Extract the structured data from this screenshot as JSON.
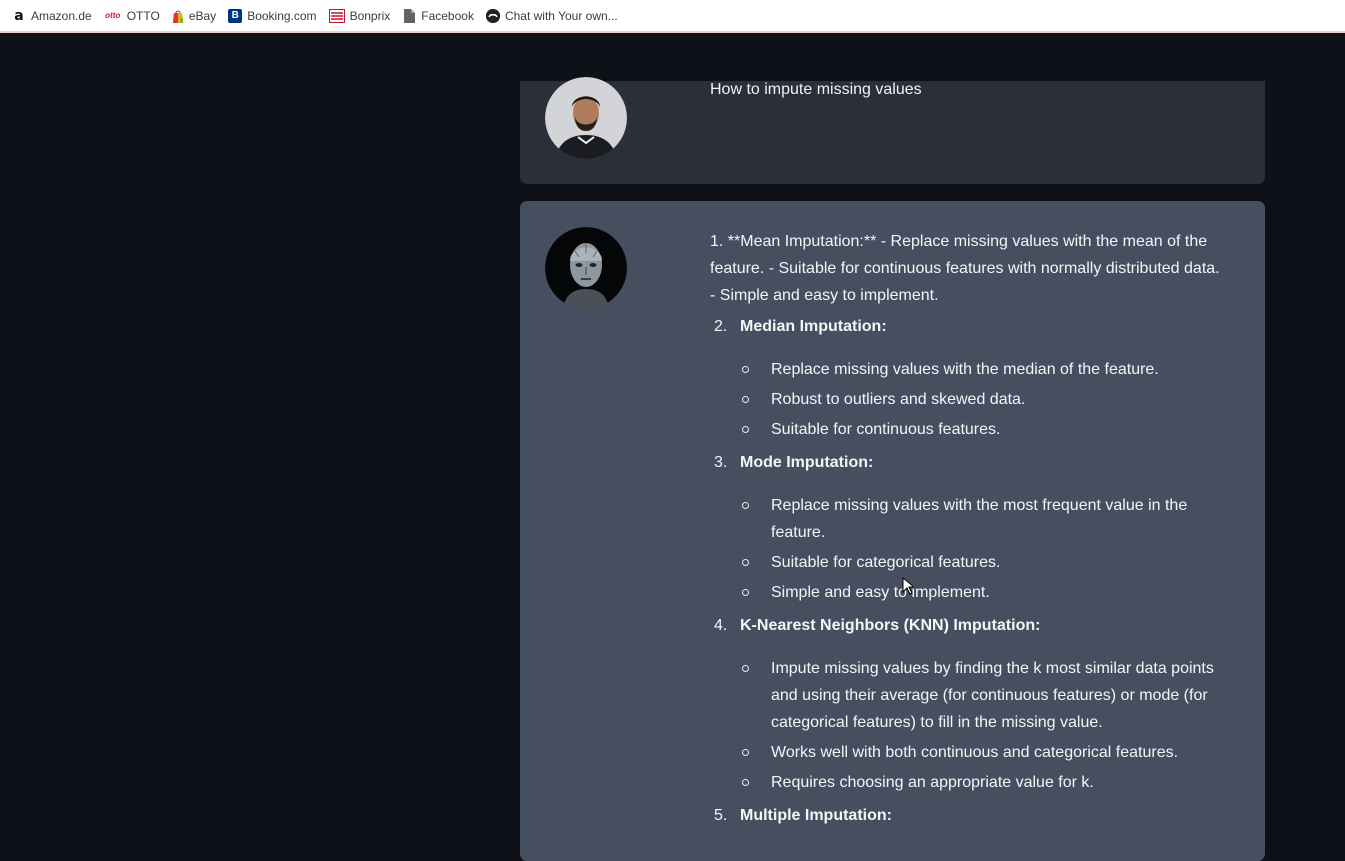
{
  "bookmarks": [
    {
      "label": "Amazon.de",
      "icon": "amazon-icon"
    },
    {
      "label": "OTTO",
      "icon": "otto-icon"
    },
    {
      "label": "eBay",
      "icon": "ebay-icon"
    },
    {
      "label": "Booking.com",
      "icon": "booking-icon"
    },
    {
      "label": "Bonprix",
      "icon": "bonprix-icon"
    },
    {
      "label": "Facebook",
      "icon": "document-icon"
    },
    {
      "label": "Chat with Your own...",
      "icon": "chat-app-icon"
    }
  ],
  "chat": {
    "user_message": "How to impute missing values",
    "bot": {
      "intro": "1. **Mean Imputation:** - Replace missing values with the mean of the feature. - Suitable for continuous features with normally distributed data. - Simple and easy to implement.",
      "items": [
        {
          "num": "2.",
          "title": "Median Imputation:",
          "subs": [
            "Replace missing values with the median of the feature.",
            "Robust to outliers and skewed data.",
            "Suitable for continuous features."
          ]
        },
        {
          "num": "3.",
          "title": "Mode Imputation:",
          "subs": [
            "Replace missing values with the most frequent value in the feature.",
            "Suitable for categorical features.",
            "Simple and easy to implement."
          ]
        },
        {
          "num": "4.",
          "title": "K-Nearest Neighbors (KNN) Imputation:",
          "subs": [
            "Impute missing values by finding the k most similar data points and using their average (for continuous features) or mode (for categorical features) to fill in the missing value.",
            "Works well with both continuous and categorical features.",
            "Requires choosing an appropriate value for k."
          ]
        },
        {
          "num": "5.",
          "title": "Multiple Imputation:",
          "subs": []
        }
      ]
    }
  },
  "colors": {
    "page_bg": "#0e1117",
    "user_bubble": "#2b2f3a",
    "bot_bubble": "#464f60"
  }
}
